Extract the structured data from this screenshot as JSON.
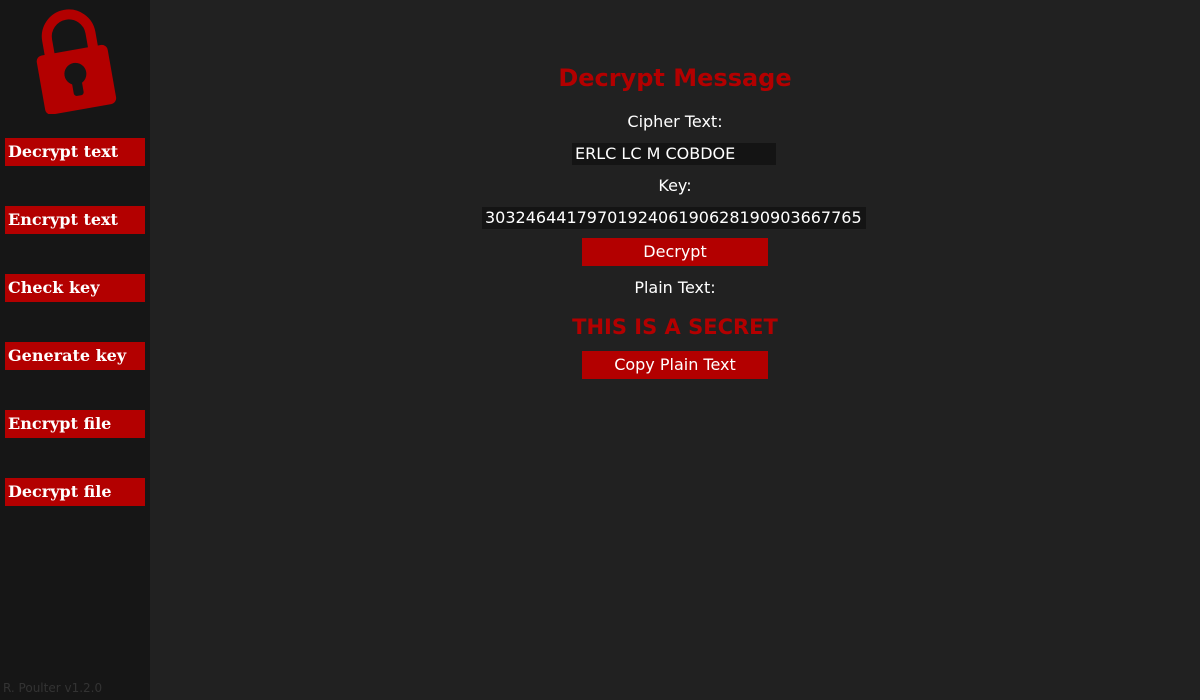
{
  "sidebar": {
    "logo_icon": "padlock-icon",
    "items": [
      {
        "label": "Decrypt text"
      },
      {
        "label": "Encrypt text"
      },
      {
        "label": "Check key"
      },
      {
        "label": "Generate key"
      },
      {
        "label": "Encrypt file"
      },
      {
        "label": "Decrypt file"
      }
    ],
    "version": "R. Poulter v1.2.0"
  },
  "main": {
    "title": "Decrypt Message",
    "cipher_label": "Cipher Text:",
    "cipher_value": "ERLC LC M COBDOE",
    "key_label": "Key:",
    "key_value": "3032464417970192406190628190903667765",
    "decrypt_button": "Decrypt",
    "plain_label": "Plain Text:",
    "plain_value": "THIS IS A SECRET",
    "copy_button": "Copy Plain Text"
  },
  "colors": {
    "accent": "#b30000",
    "sidebar_bg": "#161616",
    "main_bg": "#212121",
    "field_bg": "#141414"
  }
}
